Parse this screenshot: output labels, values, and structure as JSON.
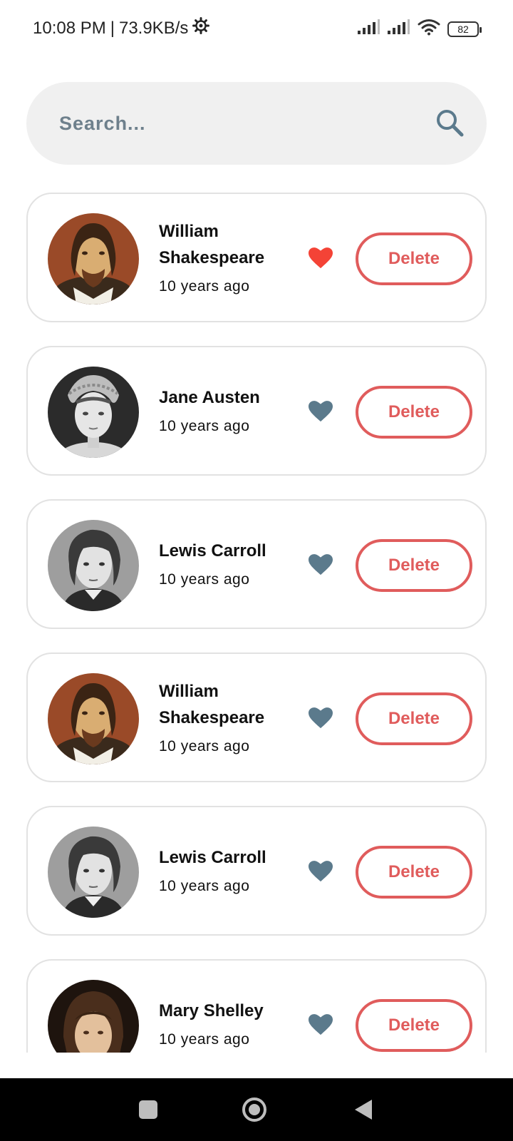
{
  "status_bar": {
    "time": "10:08 PM",
    "network_speed": "73.9KB/s",
    "battery_level": "82"
  },
  "search": {
    "placeholder": "Search..."
  },
  "colors": {
    "favorite_active": "#f44336",
    "favorite_inactive": "#5b7a8c",
    "delete_accent": "#e05c5c"
  },
  "authors": [
    {
      "name": "William Shakespeare",
      "time": "10 years ago",
      "favorite": true,
      "delete_label": "Delete",
      "avatar": "shakespeare-portrait"
    },
    {
      "name": "Jane Austen",
      "time": "10 years ago",
      "favorite": false,
      "delete_label": "Delete",
      "avatar": "austen-portrait"
    },
    {
      "name": "Lewis Carroll",
      "time": "10 years ago",
      "favorite": false,
      "delete_label": "Delete",
      "avatar": "carroll-portrait"
    },
    {
      "name": "William Shakespeare",
      "time": "10 years ago",
      "favorite": false,
      "delete_label": "Delete",
      "avatar": "shakespeare-portrait"
    },
    {
      "name": "Lewis Carroll",
      "time": "10 years ago",
      "favorite": false,
      "delete_label": "Delete",
      "avatar": "carroll-portrait"
    },
    {
      "name": "Mary Shelley",
      "time": "10 years ago",
      "favorite": false,
      "delete_label": "Delete",
      "avatar": "shelley-portrait"
    }
  ]
}
